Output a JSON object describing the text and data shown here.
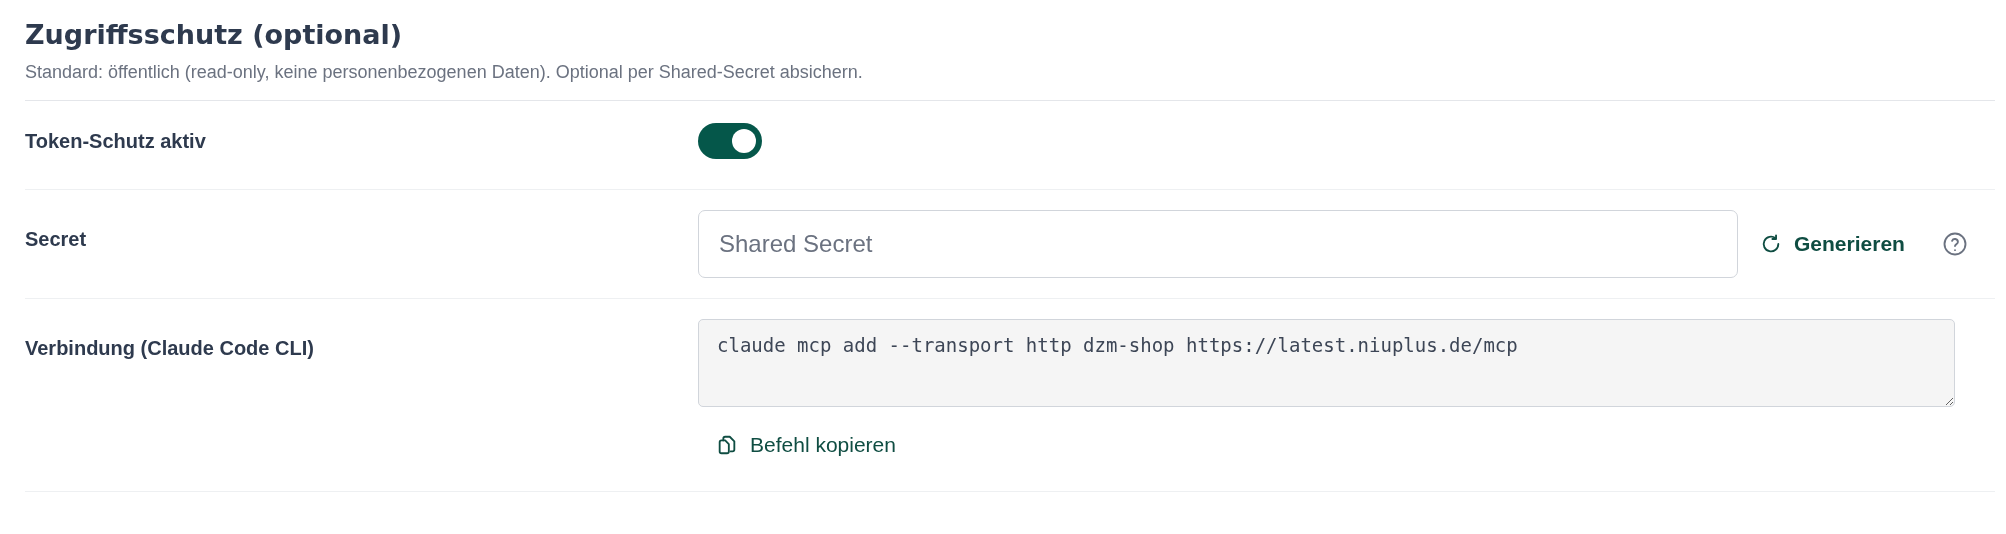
{
  "section": {
    "title": "Zugriffsschutz (optional)",
    "description": "Standard: öffentlich (read-only, keine personenbezogenen Daten). Optional per Shared-Secret absichern."
  },
  "rows": [
    {
      "kind": "toggle",
      "label": "Token-Schutz aktiv",
      "on": true
    },
    {
      "kind": "input",
      "label": "Secret",
      "placeholder": "Shared Secret",
      "action": "Generieren"
    },
    {
      "kind": "code",
      "label": "Verbindung (Claude Code CLI)",
      "value": "claude mcp add --transport http dzm-shop https://latest.niuplus.de/mcp",
      "action": "Befehl kopieren"
    }
  ]
}
